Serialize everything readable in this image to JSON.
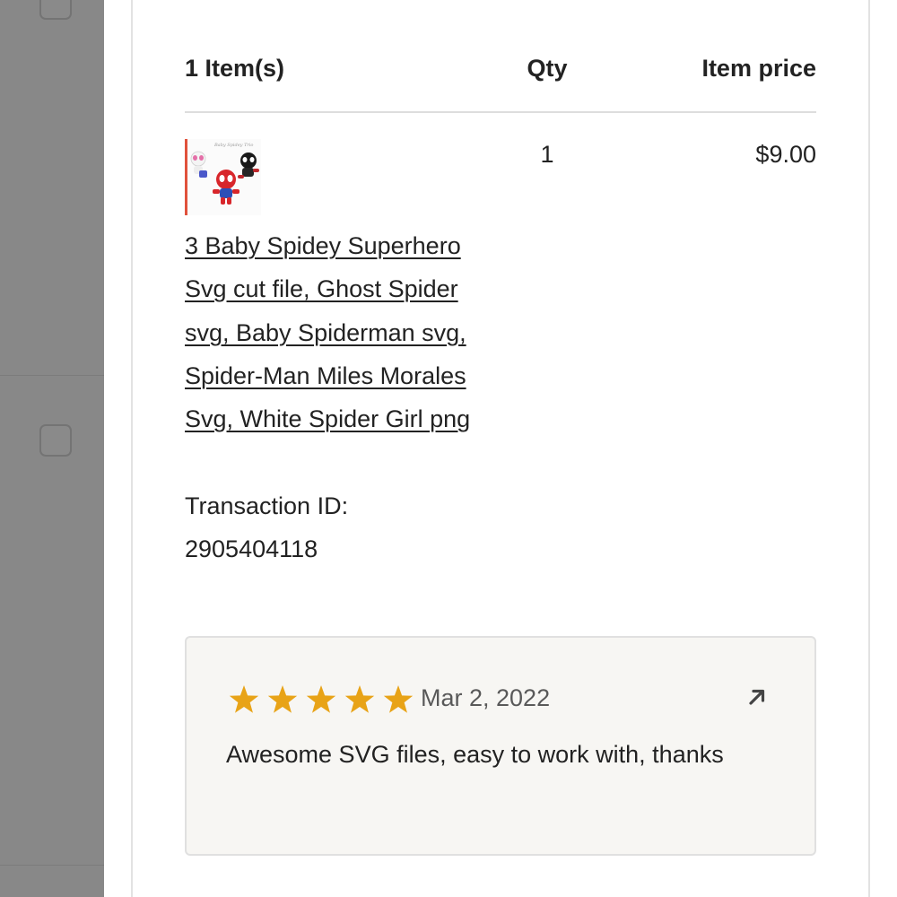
{
  "order": {
    "items_header": "1 Item(s)",
    "qty_header": "Qty",
    "price_header": "Item price",
    "item": {
      "title": "3 Baby Spidey Superhero Svg cut file, Ghost Spider svg, Baby Spiderman svg, Spider-Man Miles Morales Svg, White Spider Girl png",
      "thumbnail_caption": "Baby Spidey Trio",
      "transaction_label": "Transaction ID:",
      "transaction_id": "2905404118",
      "qty": "1",
      "price": "$9.00"
    }
  },
  "review": {
    "rating": 5,
    "rating_max": 5,
    "date": "Mar 2, 2022",
    "text": "Awesome SVG files, easy to work with, thanks",
    "link_icon": "arrow-up-right-icon"
  },
  "colors": {
    "star": "#e8a317",
    "overlay": "#888888",
    "review_bg": "#f7f6f3"
  }
}
